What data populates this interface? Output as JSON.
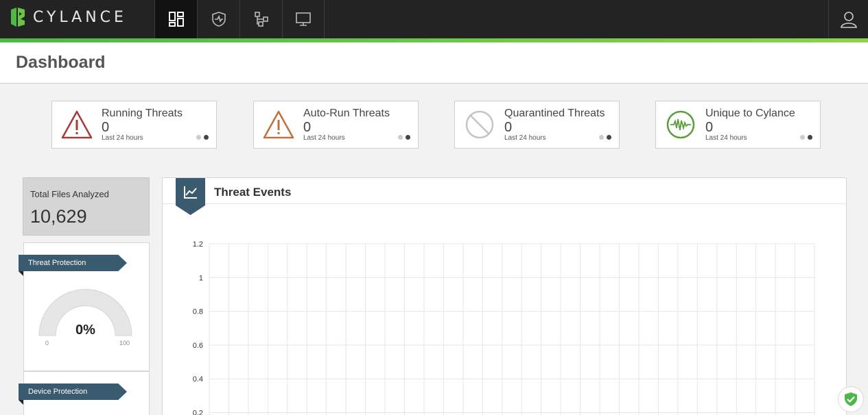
{
  "app": {
    "brand": "CYLANCE"
  },
  "nav": [
    {
      "name": "dashboard",
      "active": true
    },
    {
      "name": "protection",
      "active": false
    },
    {
      "name": "zones",
      "active": false
    },
    {
      "name": "devices",
      "active": false
    }
  ],
  "header": {
    "title": "Dashboard"
  },
  "cards": [
    {
      "label": "Running Threats",
      "value": "0",
      "sub": "Last 24 hours",
      "icon": "warning-icon",
      "color": "#a33b3b"
    },
    {
      "label": "Auto-Run Threats",
      "value": "0",
      "sub": "Last 24 hours",
      "icon": "warning-icon",
      "color": "#c0703a"
    },
    {
      "label": "Quarantined Threats",
      "value": "0",
      "sub": "Last 24 hours",
      "icon": "blocked-icon",
      "color": "#bdbdbd"
    },
    {
      "label": "Unique to Cylance",
      "value": "0",
      "sub": "Last 24 hours",
      "icon": "waveform-icon",
      "color": "#5a9e3c"
    }
  ],
  "files": {
    "label": "Total Files Analyzed",
    "value": "10,629"
  },
  "threat_protection": {
    "label": "Threat Protection",
    "value": "0%",
    "min": "0",
    "max": "100",
    "percent": 0
  },
  "device_protection": {
    "label": "Device Protection"
  },
  "chart": {
    "title": "Threat Events"
  },
  "chart_data": {
    "type": "line",
    "title": "Threat Events",
    "y_ticks": [
      "1.2",
      "1",
      "0.8",
      "0.6",
      "0.4",
      "0.2"
    ],
    "ylim": [
      0,
      1.2
    ],
    "grid": true,
    "series": []
  },
  "colors": {
    "accent": "#4cb848",
    "topbar": "#232323",
    "flag": "#3a5a70"
  }
}
